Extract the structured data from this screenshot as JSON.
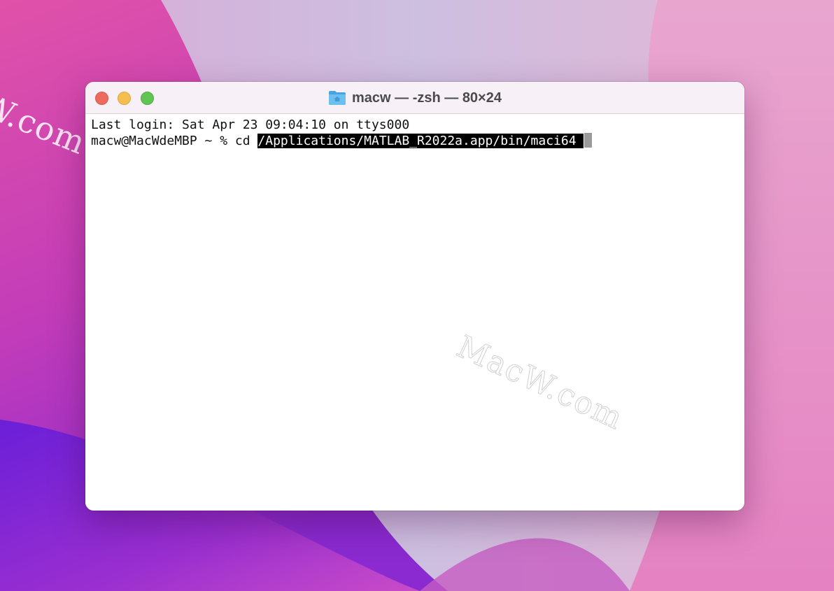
{
  "window": {
    "title": "macw — -zsh — 80×24"
  },
  "terminal": {
    "lines": [
      "Last login: Sat Apr 23 09:04:10 on ttys000"
    ],
    "prompt": "macw@MacWdeMBP ~ % cd ",
    "selected_text": "/Applications/MATLAB_R2022a.app/bin/maci64 "
  },
  "watermarks": {
    "wallpaper": "W.com",
    "window": "MacW.com"
  },
  "icons": {
    "title_folder": "home-folder-icon"
  },
  "colors": {
    "close": "#ed6a5e",
    "minimize": "#f5bf4f",
    "zoom": "#61c554",
    "selection_bg": "#000000",
    "cursor": "#9a9a9a"
  }
}
